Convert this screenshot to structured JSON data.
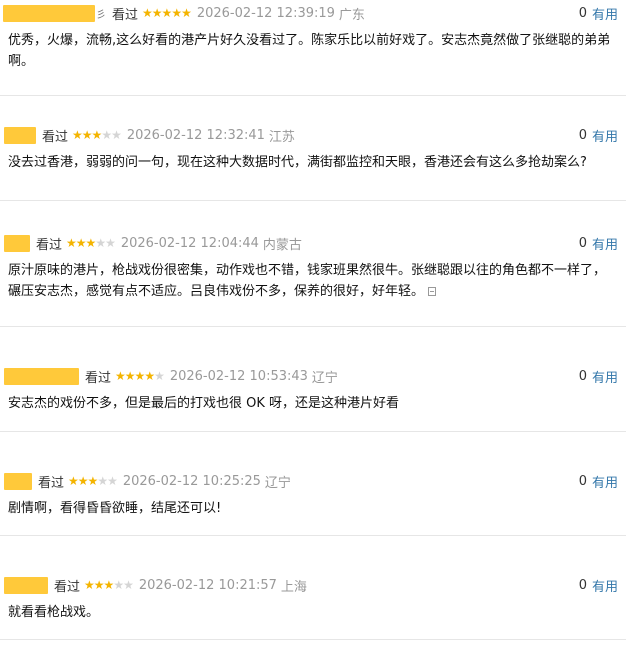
{
  "reviews": [
    {
      "user_tail": "彡",
      "status": "看过",
      "rating": 5,
      "time": "2026-02-12 12:39:19",
      "region": "广东",
      "useful_count": "0",
      "useful_label": "有用",
      "text": "优秀，火爆，流畅,这么好看的港产片好久没看过了。陈家乐比以前好戏了。安志杰竟然做了张继聪的弟弟啊。",
      "has_expand": false
    },
    {
      "user_tail": "",
      "status": "看过",
      "rating": 3,
      "time": "2026-02-12 12:32:41",
      "region": "江苏",
      "useful_count": "0",
      "useful_label": "有用",
      "text": "没去过香港，弱弱的问一句，现在这种大数据时代，满街都监控和天眼，香港还会有这么多抢劫案么?",
      "has_expand": false
    },
    {
      "user_tail": "",
      "status": "看过",
      "rating": 3,
      "time": "2026-02-12 12:04:44",
      "region": "内蒙古",
      "useful_count": "0",
      "useful_label": "有用",
      "text": "原汁原味的港片，枪战戏份很密集，动作戏也不错，钱家班果然很牛。张继聪跟以往的角色都不一样了，碾压安志杰，感觉有点不适应。吕良伟戏份不多，保养的很好，好年轻。",
      "has_expand": true
    },
    {
      "user_tail": "",
      "status": "看过",
      "rating": 4,
      "time": "2026-02-12 10:53:43",
      "region": "辽宁",
      "useful_count": "0",
      "useful_label": "有用",
      "text": "安志杰的戏份不多，但是最后的打戏也很 OK 呀，还是这种港片好看",
      "has_expand": false
    },
    {
      "user_tail": "",
      "status": "看过",
      "rating": 3,
      "time": "2026-02-12 10:25:25",
      "region": "辽宁",
      "useful_count": "0",
      "useful_label": "有用",
      "text": "剧情啊，看得昏昏欲睡，结尾还可以!",
      "has_expand": false
    },
    {
      "user_tail": "",
      "status": "看过",
      "rating": 3,
      "time": "2026-02-12 10:21:57",
      "region": "上海",
      "useful_count": "0",
      "useful_label": "有用",
      "text": "就看看枪战戏。",
      "has_expand": false
    }
  ],
  "colors": {
    "highlight": "#ffc93a",
    "star": "#f4b400",
    "link": "#3377aa"
  }
}
